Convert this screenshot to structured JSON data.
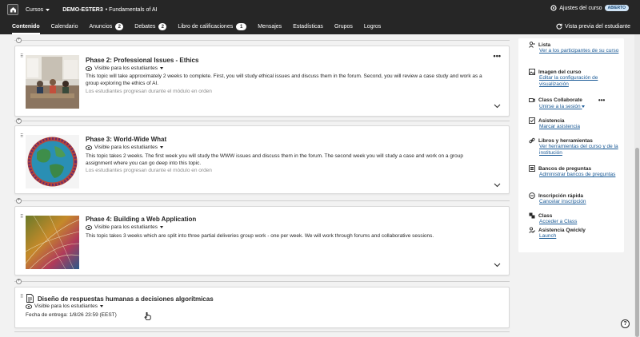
{
  "topbar": {
    "cursos_label": "Cursos",
    "course_code": "DEMO-ESTER3",
    "course_name": "• Fundamentals of AI",
    "settings_label": "Ajustes del curso",
    "status_badge": "ABIERTO"
  },
  "nav": {
    "tabs": [
      {
        "label": "Contenido"
      },
      {
        "label": "Calendario"
      },
      {
        "label": "Anuncios",
        "count": "2"
      },
      {
        "label": "Debates",
        "count": "2"
      },
      {
        "label": "Libro de calificaciones",
        "count": "1"
      },
      {
        "label": "Mensajes"
      },
      {
        "label": "Estadísticas"
      },
      {
        "label": "Grupos"
      },
      {
        "label": "Logros"
      }
    ],
    "preview_label": "Vista previa del estudiante"
  },
  "content": {
    "items": [
      {
        "title": "Phase 2: Professional Issues - Ethics",
        "visibility": "Visible para los estudiantes",
        "description": "This topic will take approximately 2 weeks to complete. First, you will study ethical issues and discuss them in the forum. Second, you will review a case study and work as a group exploring the ethics of AI.",
        "note": "Los estudiantes progresan durante el módulo en orden"
      },
      {
        "title": "Phase 3: World-Wide What",
        "visibility": "Visible para los estudiantes",
        "description": "This topic takes 2 weeks. The first week you will study the WWW issues and discuss them in the forum. The second week you will study a case and work on a group assignment where you can go deep into this topic.",
        "note": "Los estudiantes progresan durante el módulo en orden"
      },
      {
        "title": "Phase 4: Building a Web Application",
        "visibility": "Visible para los estudiantes",
        "description": "This topic takes 3 weeks which are split into three partial deliveries group work - one per week. We will work through forums and collaborative sessions."
      },
      {
        "title": "Diseño de respuestas humanas a decisiones algorítmicas",
        "visibility": "Visible para los estudiantes",
        "due": "Fecha de entrega: 1/8/26 23:59 (EEST)"
      }
    ]
  },
  "sidebar": {
    "items": [
      {
        "title": "Lista",
        "link": "Ver a los participantes de su curso"
      },
      {
        "title": "Imagen del curso",
        "link": "Editar la configuración de visualización"
      },
      {
        "title": "Class Collaborate",
        "link": "Unirse a la sesión"
      },
      {
        "title": "Asistencia",
        "link": "Marcar asistencia"
      },
      {
        "title": "Libros y herramientas",
        "link": "Ver herramientas del curso y de la institución"
      },
      {
        "title": "Bancos de preguntas",
        "link": "Administrar bancos de preguntas"
      },
      {
        "title": "Inscripción rápida",
        "link": "Cancelar inscripción"
      },
      {
        "title": "Class",
        "link": "Acceder a Class"
      },
      {
        "title": "Asistencia Qwickly",
        "link": "Launch"
      }
    ]
  },
  "help_label": "?"
}
